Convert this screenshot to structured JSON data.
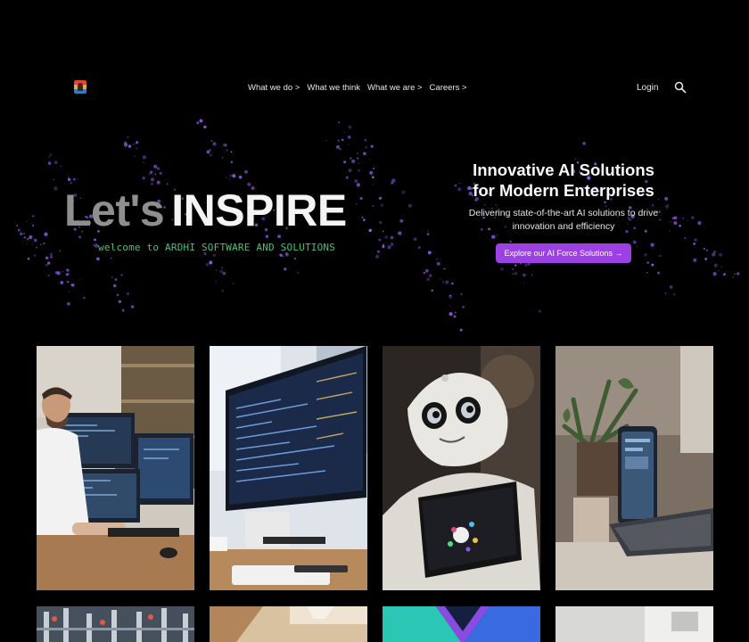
{
  "header": {
    "logo_icon": "company-logo",
    "nav": [
      {
        "label": "What we do >"
      },
      {
        "label": "What we think"
      },
      {
        "label": "What we are >"
      },
      {
        "label": "Careers >"
      }
    ],
    "login_label": "Login",
    "search_icon": "search-icon"
  },
  "hero": {
    "title_part1": "Let's",
    "title_part2": "INSPIRE",
    "welcome": "welcome to ARDHI SOFTWARE AND SOLUTIONS",
    "headline": "Innovative AI Solutions for Modern Enterprises",
    "subline": "Delivering state-of-the-art AI solutions to drive innovation and efficiency",
    "cta_label": "Explore our AI Force Solutions →"
  },
  "colors": {
    "background": "#000000",
    "accent": "#9c3fe4",
    "welcome_text": "#4cbf7a",
    "particle": "#a463ff"
  }
}
